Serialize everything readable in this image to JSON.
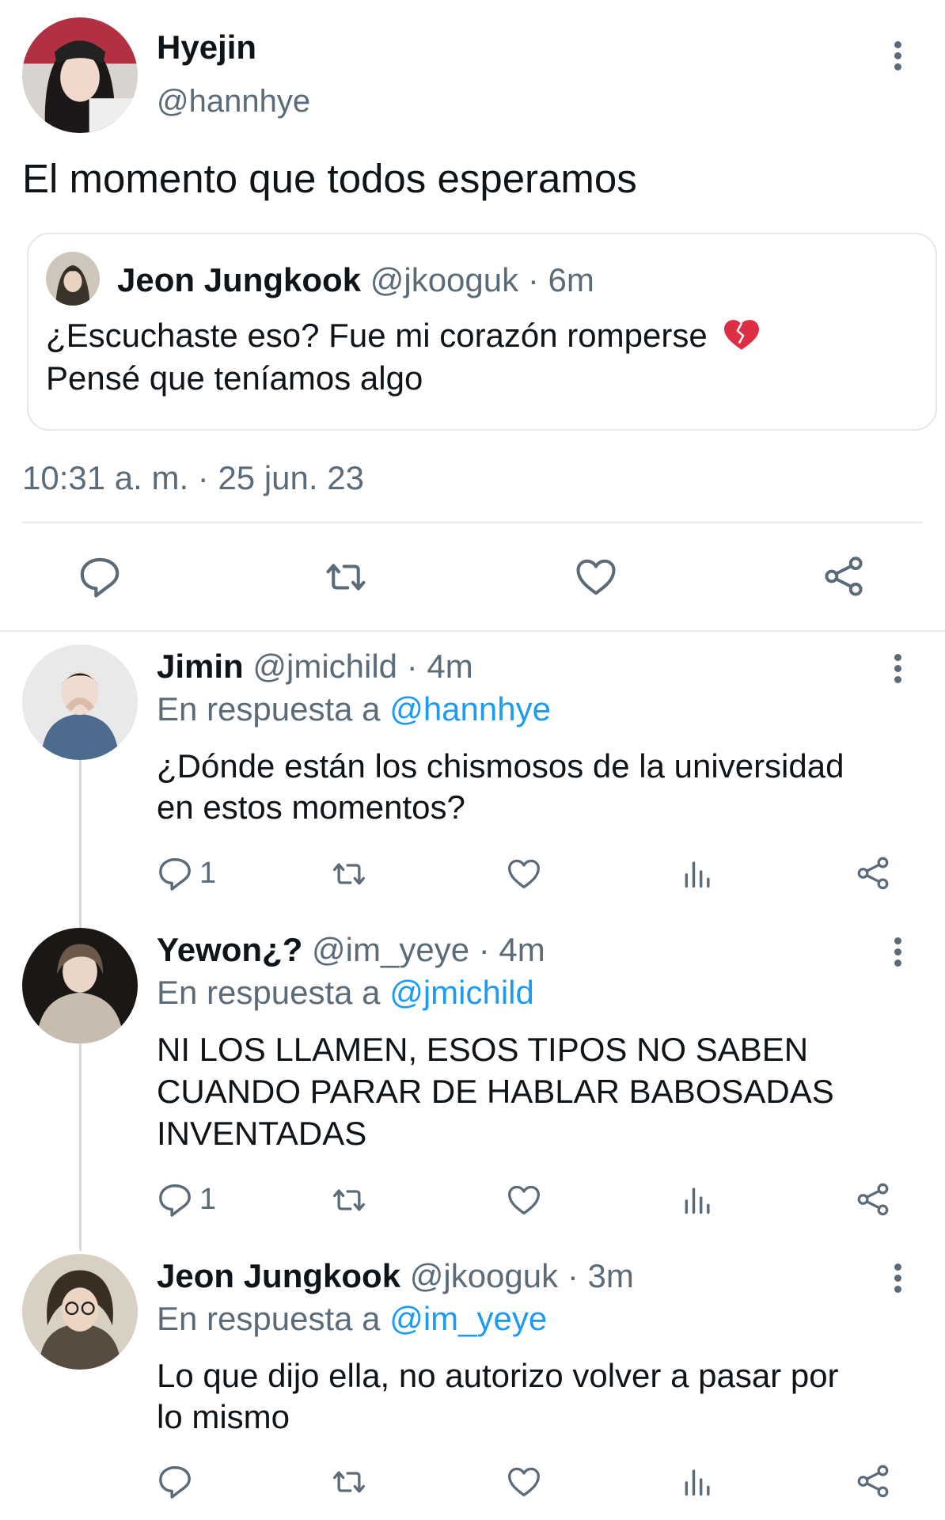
{
  "main_tweet": {
    "name": "Hyejin",
    "handle": "@hannhye",
    "text": "El momento que todos esperamos",
    "timestamp": "10:31 a. m. · 25 jun. 23",
    "quoted": {
      "name": "Jeon Jungkook",
      "handle": "@jkooguk",
      "time": "6m",
      "sep": "·",
      "line1": "¿Escuchaste eso? Fue mi corazón romperse",
      "emoji": "broken-heart",
      "line2": "Pensé que teníamos algo"
    }
  },
  "replies": [
    {
      "name": "Jimin",
      "handle": "@jmichild",
      "time": "4m",
      "sep": "·",
      "reply_prefix": "En respuesta a",
      "reply_to": "@hannhye",
      "lines": [
        "¿Dónde están los chismosos de la universidad",
        "en estos momentos?"
      ],
      "reply_count": "1"
    },
    {
      "name": "Yewon¿?",
      "handle": "@im_yeye",
      "time": "4m",
      "sep": "·",
      "reply_prefix": "En respuesta a",
      "reply_to": "@jmichild",
      "lines": [
        "NI LOS LLAMEN, ESOS TIPOS NO SABEN",
        "CUANDO PARAR DE HABLAR BABOSADAS",
        "INVENTADAS"
      ],
      "reply_count": "1"
    },
    {
      "name": "Jeon Jungkook",
      "handle": "@jkooguk",
      "time": "3m",
      "sep": "·",
      "reply_prefix": "En respuesta a",
      "reply_to": "@im_yeye",
      "lines": [
        "Lo que dijo ella, no autorizo volver a pasar por",
        "lo mismo"
      ],
      "reply_count": ""
    }
  ],
  "icons": [
    "more-icon",
    "reply-icon",
    "retweet-icon",
    "like-icon",
    "views-icon",
    "share-icon",
    "broken-heart-icon"
  ],
  "colors": {
    "text": "#0f1419",
    "muted": "#5b6b78",
    "link": "#1d9bf0",
    "divider": "#e6ecf0"
  }
}
